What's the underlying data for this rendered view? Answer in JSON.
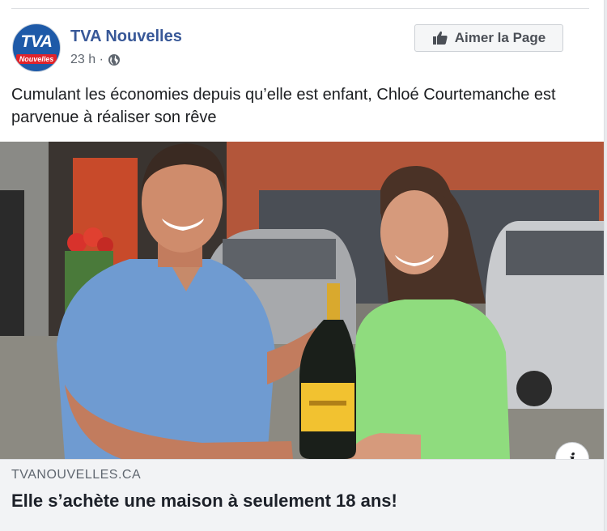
{
  "post": {
    "page_name": "TVA Nouvelles",
    "avatar_logo": "TVA",
    "avatar_sub": "Nouvelles",
    "time": "23 h ·",
    "audience_icon": "globe-icon",
    "like_button": "Aimer la Page",
    "text": "Cumulant les économies depuis qu’elle est enfant, Chloé Courtemanche est parvenue à réaliser son rêve"
  },
  "link": {
    "domain": "TVANOUVELLES.CA",
    "headline": "Elle s’achète une maison à seulement 18 ans!",
    "info_icon": "i"
  },
  "colors": {
    "page_name": "#385898",
    "link_bg": "#f2f3f5",
    "brand_blue": "#1e5aa8",
    "brand_red": "#e1232a"
  }
}
